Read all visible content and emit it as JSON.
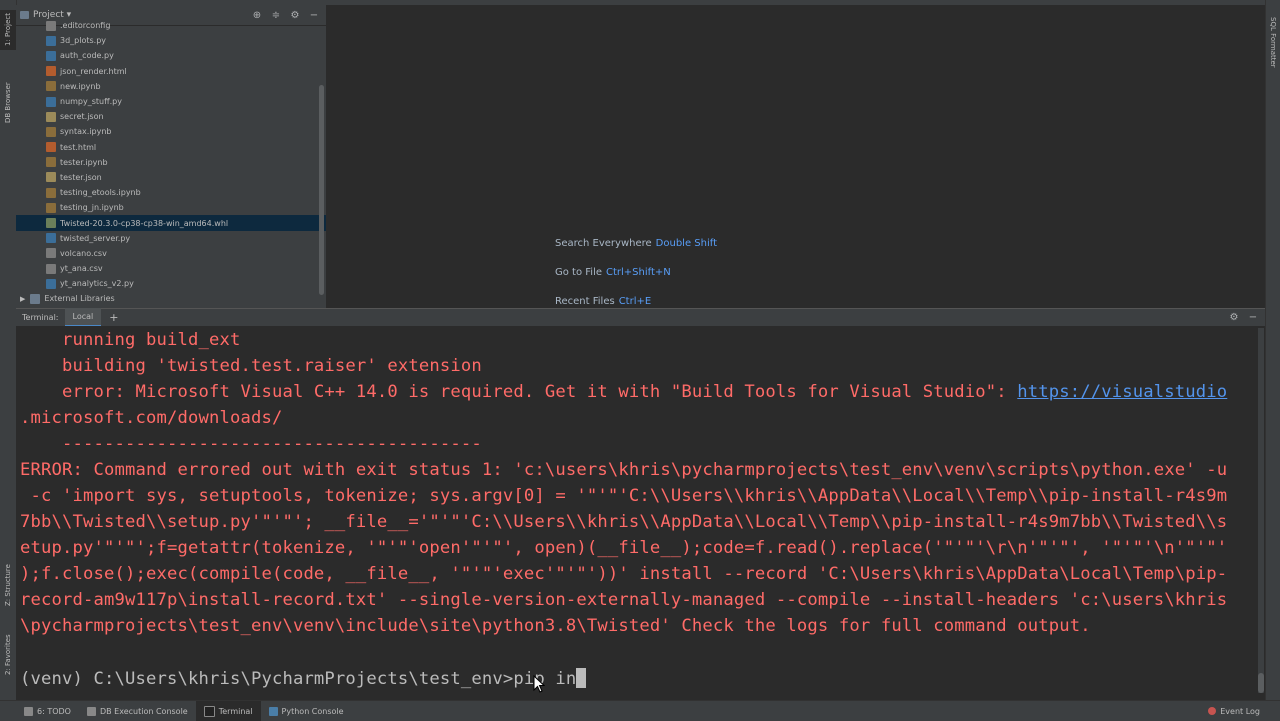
{
  "left_strip": {
    "project_tab": "1: Project",
    "db_tab": "DB Browser",
    "structure_tab": "Z: Structure",
    "favorites_tab": "2: Favorites"
  },
  "right_strip": {
    "sql_tab": "SQL Formatter"
  },
  "project": {
    "header_label": "Project",
    "files": [
      {
        "name": ".editorconfig",
        "type": "cfg"
      },
      {
        "name": "3d_plots.py",
        "type": "py"
      },
      {
        "name": "auth_code.py",
        "type": "py"
      },
      {
        "name": "json_render.html",
        "type": "html"
      },
      {
        "name": "new.ipynb",
        "type": "nb"
      },
      {
        "name": "numpy_stuff.py",
        "type": "py"
      },
      {
        "name": "secret.json",
        "type": "json"
      },
      {
        "name": "syntax.ipynb",
        "type": "nb"
      },
      {
        "name": "test.html",
        "type": "html"
      },
      {
        "name": "tester.ipynb",
        "type": "nb"
      },
      {
        "name": "tester.json",
        "type": "json"
      },
      {
        "name": "testing_etools.ipynb",
        "type": "nb"
      },
      {
        "name": "testing_jn.ipynb",
        "type": "nb"
      },
      {
        "name": "Twisted-20.3.0-cp38-cp38-win_amd64.whl",
        "type": "whl",
        "selected": true
      },
      {
        "name": "twisted_server.py",
        "type": "py"
      },
      {
        "name": "volcano.csv",
        "type": "csv"
      },
      {
        "name": "yt_ana.csv",
        "type": "csv"
      },
      {
        "name": "yt_analytics_v2.py",
        "type": "py"
      }
    ],
    "external_libraries": "External Libraries"
  },
  "editor_hints": {
    "search_label": "Search Everywhere",
    "search_key": "Double Shift",
    "goto_label": "Go to File",
    "goto_key": "Ctrl+Shift+N",
    "recent_label": "Recent Files",
    "recent_key": "Ctrl+E"
  },
  "terminal": {
    "title": "Terminal:",
    "tab": "Local",
    "plus": "+",
    "lines": [
      "    running build_ext",
      "    building 'twisted.test.raiser' extension",
      "    error: Microsoft Visual C++ 14.0 is required. Get it with \"Build Tools for Visual Studio\": ",
      ".microsoft.com/downloads/",
      "    ----------------------------------------",
      "ERROR: Command errored out with exit status 1: 'c:\\users\\khris\\pycharmprojects\\test_env\\venv\\scripts\\python.exe' -u",
      " -c 'import sys, setuptools, tokenize; sys.argv[0] = '\"'\"'C:\\\\Users\\\\khris\\\\AppData\\\\Local\\\\Temp\\\\pip-install-r4s9m",
      "7bb\\\\Twisted\\\\setup.py'\"'\"'; __file__='\"'\"'C:\\\\Users\\\\khris\\\\AppData\\\\Local\\\\Temp\\\\pip-install-r4s9m7bb\\\\Twisted\\\\s",
      "etup.py'\"'\"';f=getattr(tokenize, '\"'\"'open'\"'\"', open)(__file__);code=f.read().replace('\"'\"'\\r\\n'\"'\"', '\"'\"'\\n'\"'\"'",
      ");f.close();exec(compile(code, __file__, '\"'\"'exec'\"'\"'))' install --record 'C:\\Users\\khris\\AppData\\Local\\Temp\\pip-",
      "record-am9w117p\\install-record.txt' --single-version-externally-managed --compile --install-headers 'c:\\users\\khris",
      "\\pycharmprojects\\test_env\\venv\\include\\site\\python3.8\\Twisted' Check the logs for full command output."
    ],
    "link": "https://visualstudio",
    "prompt": "(venv) C:\\Users\\khris\\PycharmProjects\\test_env>pip in"
  },
  "statusbar": {
    "todo": "6: TODO",
    "db_console": "DB Execution Console",
    "terminal": "Terminal",
    "python_console": "Python Console",
    "event_log": "Event Log"
  },
  "colors": {
    "error_text": "#ff6b68",
    "link": "#5394ec",
    "accent": "#4a88c7",
    "selected_row": "#0d293e"
  }
}
